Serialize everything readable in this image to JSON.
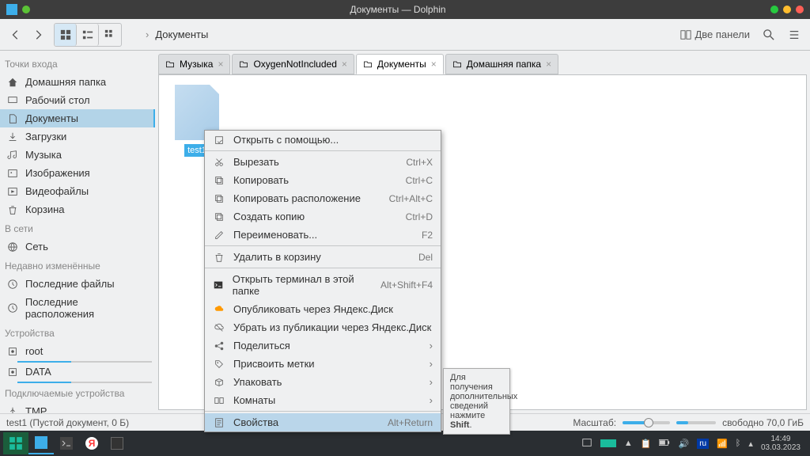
{
  "titlebar": {
    "title": "Документы — Dolphin"
  },
  "toolbar": {
    "breadcrumb": "Документы",
    "panels": "Две панели"
  },
  "sidebar": {
    "sections": [
      {
        "title": "Точки входа",
        "items": [
          {
            "icon": "home",
            "label": "Домашняя папка"
          },
          {
            "icon": "desktop",
            "label": "Рабочий стол"
          },
          {
            "icon": "docs",
            "label": "Документы",
            "selected": true
          },
          {
            "icon": "downloads",
            "label": "Загрузки"
          },
          {
            "icon": "music",
            "label": "Музыка"
          },
          {
            "icon": "images",
            "label": "Изображения"
          },
          {
            "icon": "video",
            "label": "Видеофайлы"
          },
          {
            "icon": "trash",
            "label": "Корзина"
          }
        ]
      },
      {
        "title": "В сети",
        "items": [
          {
            "icon": "network",
            "label": "Сеть"
          }
        ]
      },
      {
        "title": "Недавно изменённые",
        "items": [
          {
            "icon": "recent",
            "label": "Последние файлы"
          },
          {
            "icon": "recent",
            "label": "Последние расположения"
          }
        ]
      },
      {
        "title": "Устройства",
        "items": [
          {
            "icon": "disk",
            "label": "root",
            "disk": true
          },
          {
            "icon": "disk",
            "label": "DATA",
            "disk": true
          }
        ]
      },
      {
        "title": "Подключаемые устройства",
        "items": [
          {
            "icon": "usb",
            "label": "TMP"
          }
        ]
      }
    ]
  },
  "tabs": [
    {
      "icon": "folder",
      "label": "Музыка"
    },
    {
      "icon": "folder",
      "label": "OxygenNotIncluded"
    },
    {
      "icon": "folder",
      "label": "Документы",
      "active": true
    },
    {
      "icon": "folder",
      "label": "Домашняя папка"
    }
  ],
  "files": [
    {
      "name": "test1"
    }
  ],
  "context": [
    {
      "icon": "open",
      "label": "Открыть с помощью..."
    },
    {
      "sep": true
    },
    {
      "icon": "cut",
      "label": "Вырезать",
      "shortcut": "Ctrl+X"
    },
    {
      "icon": "copy",
      "label": "Копировать",
      "shortcut": "Ctrl+C"
    },
    {
      "icon": "copyloc",
      "label": "Копировать расположение",
      "shortcut": "Ctrl+Alt+C"
    },
    {
      "icon": "dup",
      "label": "Создать копию",
      "shortcut": "Ctrl+D"
    },
    {
      "icon": "rename",
      "label": "Переименовать...",
      "shortcut": "F2"
    },
    {
      "sep": true
    },
    {
      "icon": "trash",
      "label": "Удалить в корзину",
      "shortcut": "Del"
    },
    {
      "sep": true
    },
    {
      "icon": "terminal",
      "label": "Открыть терминал в этой папке",
      "shortcut": "Alt+Shift+F4"
    },
    {
      "icon": "cloud",
      "label": "Опубликовать через Яндекс.Диск"
    },
    {
      "icon": "cloud-off",
      "label": "Убрать из публикации через Яндекс.Диск"
    },
    {
      "icon": "share",
      "label": "Поделиться",
      "submenu": true
    },
    {
      "icon": "tag",
      "label": "Присвоить метки",
      "submenu": true
    },
    {
      "icon": "package",
      "label": "Упаковать",
      "submenu": true
    },
    {
      "icon": "activity",
      "label": "Комнаты",
      "submenu": true
    },
    {
      "sep": true
    },
    {
      "icon": "props",
      "label": "Свойства",
      "shortcut": "Alt+Return",
      "highlighted": true
    }
  ],
  "tooltip": {
    "l1": "Для получения",
    "l2": "дополнительных",
    "l3": "сведений нажмите",
    "l4": "Shift"
  },
  "status": {
    "text": "test1 (Пустой документ, 0 Б)",
    "zoom": "Масштаб:",
    "free": "свободно 70,0 ГиБ"
  },
  "taskbar": {
    "time": "14:49",
    "date": "03.03.2023",
    "locale": "ru"
  }
}
